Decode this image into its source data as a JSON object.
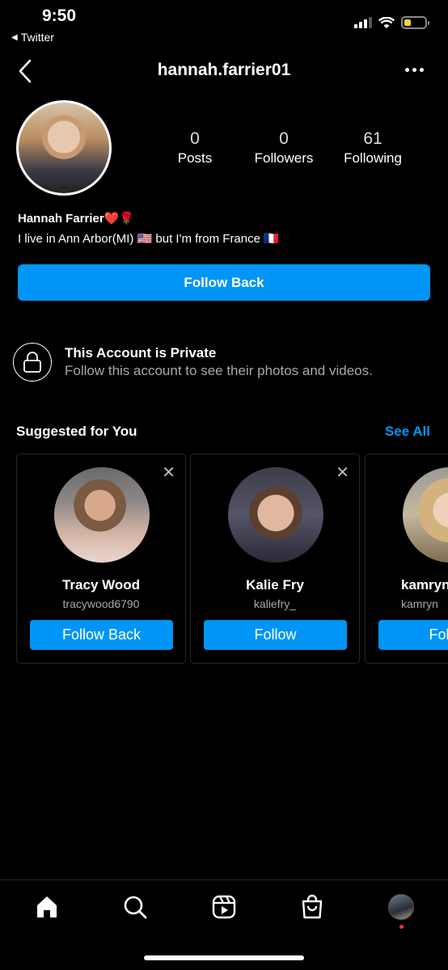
{
  "status_bar": {
    "time": "9:50",
    "back_app": "Twitter"
  },
  "header": {
    "username": "hannah.farrier01"
  },
  "profile": {
    "stats": [
      {
        "value": "0",
        "label": "Posts"
      },
      {
        "value": "0",
        "label": "Followers"
      },
      {
        "value": "61",
        "label": "Following"
      }
    ],
    "name": "Hannah Farrier❤️🌹",
    "bio": "I live in Ann Arbor(MI) 🇺🇸 but I'm from France 🇫🇷",
    "follow_back_label": "Follow Back"
  },
  "private_notice": {
    "title": "This Account is Private",
    "subtitle": "Follow this account to see their photos and videos."
  },
  "suggested": {
    "title": "Suggested for You",
    "see_all": "See All",
    "cards": [
      {
        "name": "Tracy Wood",
        "handle": "tracywood6790",
        "button": "Follow Back"
      },
      {
        "name": "Kalie Fry",
        "handle": "kaliefry_",
        "button": "Follow"
      },
      {
        "name": "kamryn",
        "handle": "kamryn",
        "button": "Follow"
      }
    ]
  },
  "nav": {
    "items": [
      "home-icon",
      "search-icon",
      "reels-icon",
      "shop-icon",
      "profile-avatar"
    ]
  },
  "colors": {
    "accent": "#0095f6",
    "background": "#000000",
    "notification_dot": "#ff3040"
  }
}
